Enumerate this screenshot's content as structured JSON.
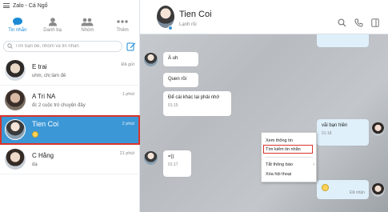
{
  "app": {
    "title": "Zalo - Cá Ngố"
  },
  "nav": {
    "tabs": [
      {
        "label": "Tin nhắn",
        "icon": "chat-bubble-icon"
      },
      {
        "label": "Danh bạ",
        "icon": "contact-icon"
      },
      {
        "label": "Nhóm",
        "icon": "group-icon"
      },
      {
        "label": "Thêm",
        "icon": "more-dots-icon"
      }
    ],
    "active_tab": "Tin nhắn"
  },
  "search": {
    "placeholder": "Tìm bạn bè, nhóm và tin nhắn"
  },
  "conversations": [
    {
      "name": "E trai",
      "preview": "uhm, chị làm đê",
      "time": "Đã gửi"
    },
    {
      "name": "A Tri NA",
      "preview": "đc 2 cuộc trò chuyện đây",
      "time": "1 phút"
    },
    {
      "name": "Tien Coi",
      "preview": "",
      "time": "2 phút",
      "selected": true
    },
    {
      "name": "C Hằng",
      "preview": "dạ",
      "time": "21 phút"
    }
  ],
  "chat": {
    "name": "Tien Coi",
    "status": "Lạnh rồi",
    "messages": [
      {
        "text": "À uh",
        "sender": "contact"
      },
      {
        "text": "Quen rồi",
        "sender": "contact"
      },
      {
        "text": "Để cái khác lại phải nhớ",
        "time": "01:15",
        "sender": "contact"
      },
      {
        "text": "vãi bạn hiền",
        "time": "01:18",
        "sender": "me"
      },
      {
        "text": "=))",
        "time": "01:17",
        "sender": "contact"
      },
      {
        "text": "",
        "status": "Đã nhận",
        "sender": "me"
      }
    ]
  },
  "context_menu": {
    "items": [
      {
        "label": "Xem thông tin"
      },
      {
        "label": "Tìm kiếm tin nhắn",
        "highlighted": true
      },
      {
        "label": "Tắt thông báo",
        "submenu": true
      },
      {
        "label": "Xóa hội thoại"
      }
    ]
  },
  "colors": {
    "accent": "#1a8ad4",
    "selected_bg": "#3c97d6",
    "highlight_border": "#d9342b"
  }
}
